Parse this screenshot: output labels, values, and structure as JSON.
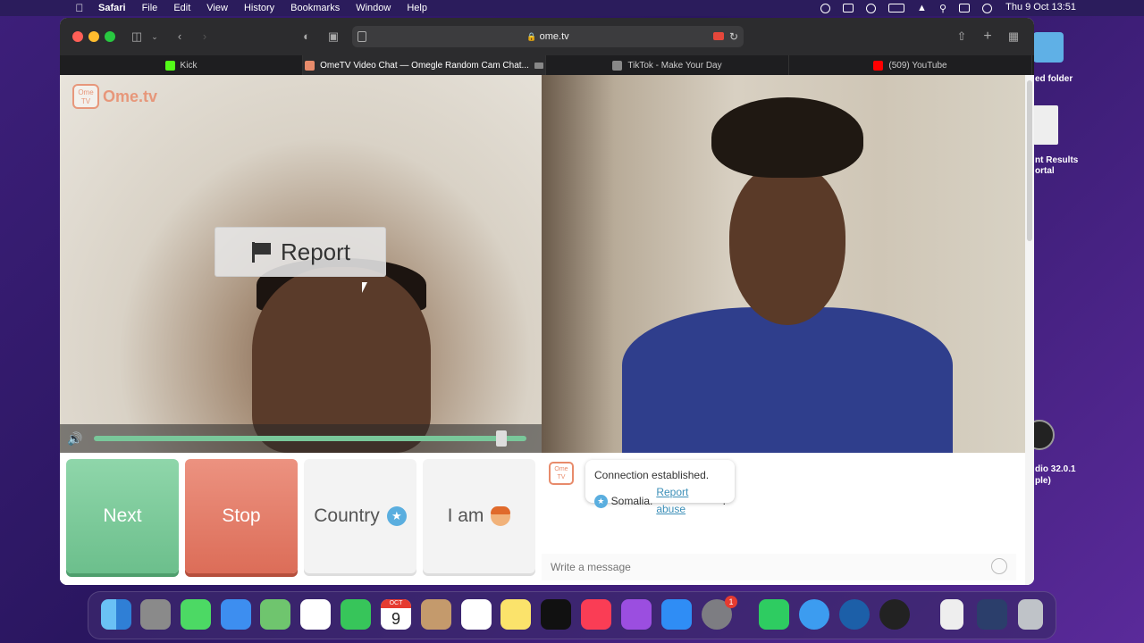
{
  "menubar": {
    "app": "Safari",
    "items": [
      "File",
      "Edit",
      "View",
      "History",
      "Bookmarks",
      "Window",
      "Help"
    ],
    "clock": "Thu 9 Oct  13:51"
  },
  "desktop": {
    "folder_label": "ed folder",
    "file_label_1": "nt Results",
    "file_label_2": "ortal",
    "obs_label_1": "dio 32.0.1",
    "obs_label_2": "ple)"
  },
  "browser": {
    "url": "ome.tv",
    "tabs": [
      {
        "title": "Kick",
        "color": "#53fc18"
      },
      {
        "title": "OmeTV Video Chat — Omegle Random Cam Chat...",
        "color": "#e88b6b"
      },
      {
        "title": "TikTok - Make Your Day",
        "color": "#888888"
      },
      {
        "title": "(509) YouTube",
        "color": "#ff0000"
      }
    ]
  },
  "ometv": {
    "logo_small": "Ome TV",
    "logo_text": "Ome.tv",
    "report_label": "Report",
    "buttons": {
      "next": "Next",
      "stop": "Stop",
      "country": "Country",
      "i_am": "I am"
    },
    "chat": {
      "status": "Connection established.",
      "country": "Somalia.",
      "report_abuse": "Report abuse",
      "input_placeholder": "Write a message"
    },
    "volume_level": 0.93
  },
  "colors": {
    "next": "#7ccb9a",
    "stop": "#e57f6a",
    "brand": "#e88b6b",
    "link": "#3c8fb8"
  },
  "dock": {
    "icons": [
      "finder-icon",
      "launchpad-icon",
      "messages-icon",
      "mail-icon",
      "maps-icon",
      "photos-icon",
      "facetime-icon",
      "calendar-icon",
      "contacts-icon",
      "reminders-icon",
      "notes-icon",
      "apple-tv-icon",
      "music-icon",
      "podcasts-icon",
      "app-store-icon",
      "system-settings-icon",
      "whatsapp-icon",
      "safari-icon",
      "quicktime-icon",
      "obs-icon",
      "file-icon",
      "screenshot-icon",
      "trash-icon"
    ],
    "calendar_month": "OCT",
    "calendar_day": "9",
    "settings_badge": "1"
  }
}
